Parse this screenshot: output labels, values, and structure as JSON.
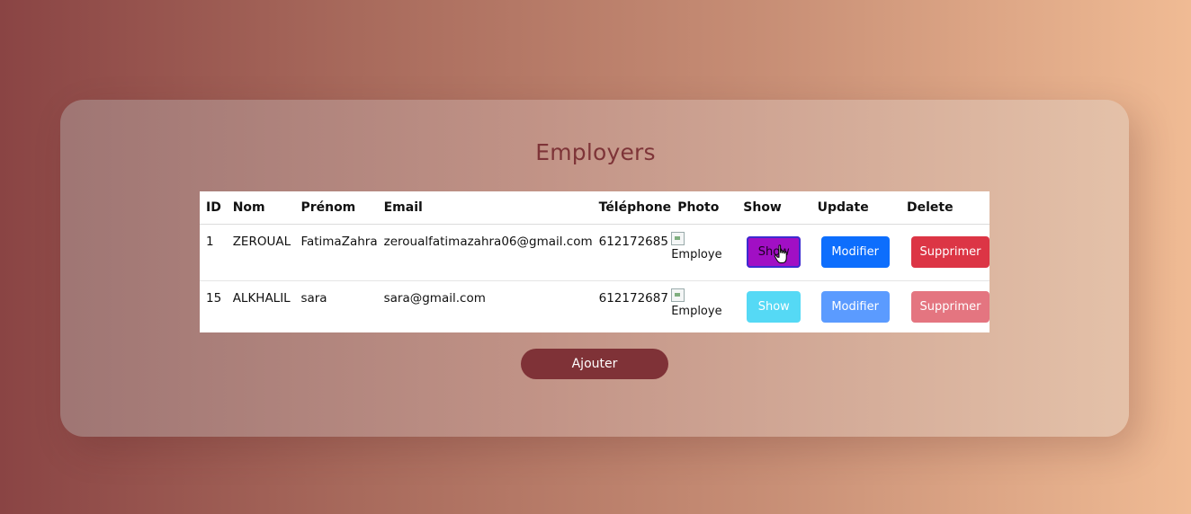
{
  "page": {
    "title": "Employers"
  },
  "table": {
    "headers": [
      "ID",
      "Nom",
      "Prénom",
      "Email",
      "Téléphone",
      "Photo",
      "Show",
      "Update",
      "Delete"
    ],
    "rows": [
      {
        "id": "1",
        "nom": "ZEROUAL",
        "prenom": "FatimaZahra",
        "email": "zeroualfatimazahra06@gmail.com",
        "telephone": "612172685",
        "photo_alt": "Employe",
        "show": "Show",
        "update": "Modifier",
        "delete": "Supprimer"
      },
      {
        "id": "15",
        "nom": "ALKHALIL",
        "prenom": "sara",
        "email": "sara@gmail.com",
        "telephone": "612172687",
        "photo_alt": "Employe",
        "show": "Show",
        "update": "Modifier",
        "delete": "Supprimer"
      }
    ]
  },
  "actions": {
    "add_label": "Ajouter"
  },
  "colors": {
    "title": "#7e3438",
    "show_active": "#a10fc4",
    "show": "#55d9f5",
    "modify": "#0d6efd",
    "delete": "#dc3545",
    "add": "#7f3237"
  },
  "icons": {
    "broken_image": "broken-image-icon",
    "cursor": "hand-pointer-icon"
  }
}
